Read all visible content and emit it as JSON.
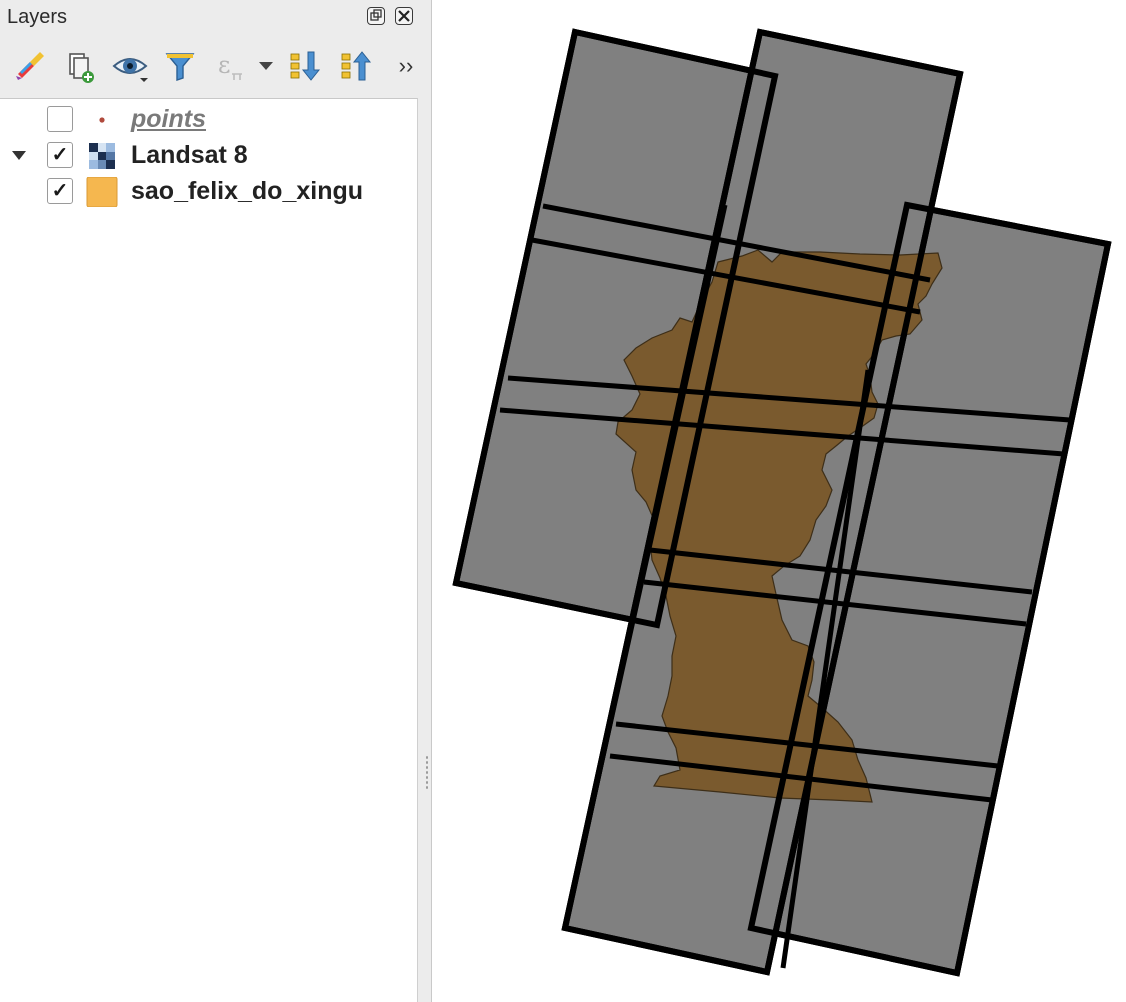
{
  "panel": {
    "title": "Layers",
    "title_buttons": [
      "float-icon",
      "close-icon"
    ]
  },
  "toolbar": {
    "buttons": [
      {
        "name": "style-manager-button",
        "icon": "paintbrush-icon"
      },
      {
        "name": "add-group-button",
        "icon": "add-group-icon"
      },
      {
        "name": "manage-visibility-button",
        "icon": "eye-icon"
      },
      {
        "name": "filter-legend-button",
        "icon": "funnel-icon"
      },
      {
        "name": "filter-expression-button",
        "icon": "epsilon-icon"
      },
      {
        "name": "expand-all-button",
        "icon": "expand-all-icon"
      },
      {
        "name": "collapse-all-button",
        "icon": "collapse-all-icon"
      },
      {
        "name": "more-tools-button",
        "icon": "chevron-double-right-icon"
      }
    ],
    "more_label": "››"
  },
  "layers": [
    {
      "name": "points",
      "checked": false,
      "type": "point",
      "icon_color": "#b04a3c"
    },
    {
      "name": "Landsat 8",
      "checked": true,
      "type": "raster",
      "expanded": true
    },
    {
      "name": "sao_felix_do_xingu",
      "checked": true,
      "type": "polygon",
      "icon_color": "#f5b74f"
    }
  ],
  "checkmark": "✓",
  "map": {
    "background": "#ffffff",
    "scene_fill": "#808080",
    "scene_outline": "#000000",
    "region_fill": "#7a5a2e"
  }
}
